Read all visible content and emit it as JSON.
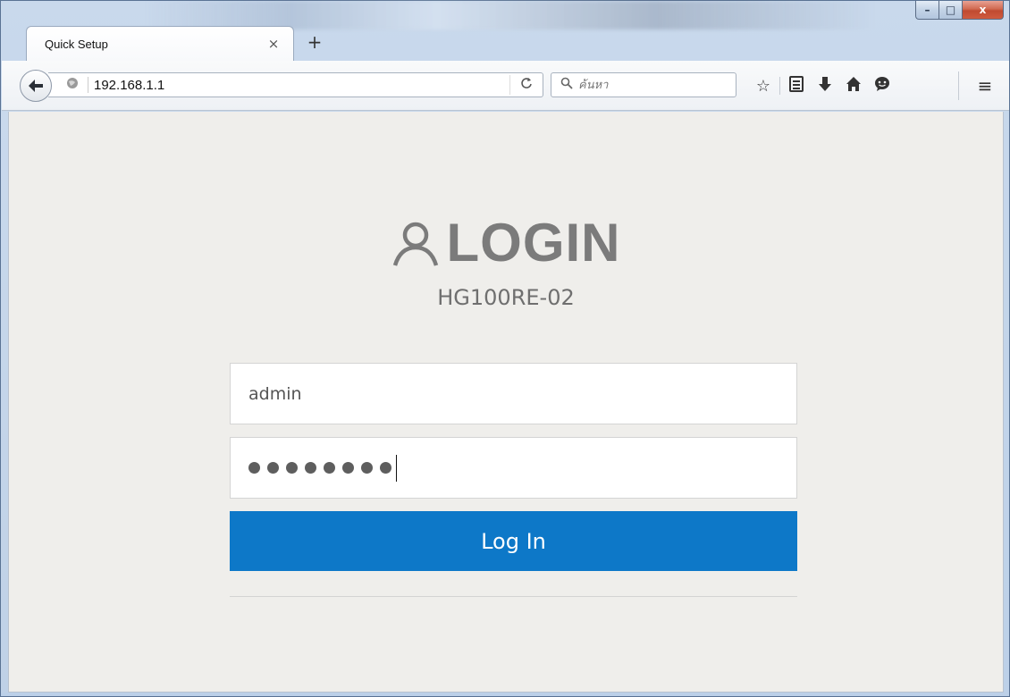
{
  "window": {
    "minimize_label": "–",
    "maximize_label": "□",
    "close_label": "x"
  },
  "tabs": [
    {
      "title": "Quick Setup",
      "close": "×"
    }
  ],
  "new_tab_label": "+",
  "navbar": {
    "back_icon": "←",
    "url": "192.168.1.1",
    "reload_icon": "C",
    "search_placeholder": "ค้นหา",
    "search_icon": "⚲",
    "toolbar_icons": [
      {
        "name": "bookmark-star-icon",
        "glyph": "☆"
      },
      {
        "name": "reading-list-icon",
        "glyph": "▤"
      },
      {
        "name": "download-icon",
        "glyph": "⬇"
      },
      {
        "name": "home-icon",
        "glyph": "⌂"
      },
      {
        "name": "chat-icon",
        "glyph": "☻"
      }
    ],
    "menu_icon": "≡"
  },
  "login": {
    "title": "LOGIN",
    "model": "HG100RE-02",
    "username_value": "admin",
    "password_length": 8,
    "button_label": "Log In"
  },
  "colors": {
    "button": "#0d78c8",
    "page_background": "#efeeeb",
    "title_gray": "#7b7b7b"
  }
}
